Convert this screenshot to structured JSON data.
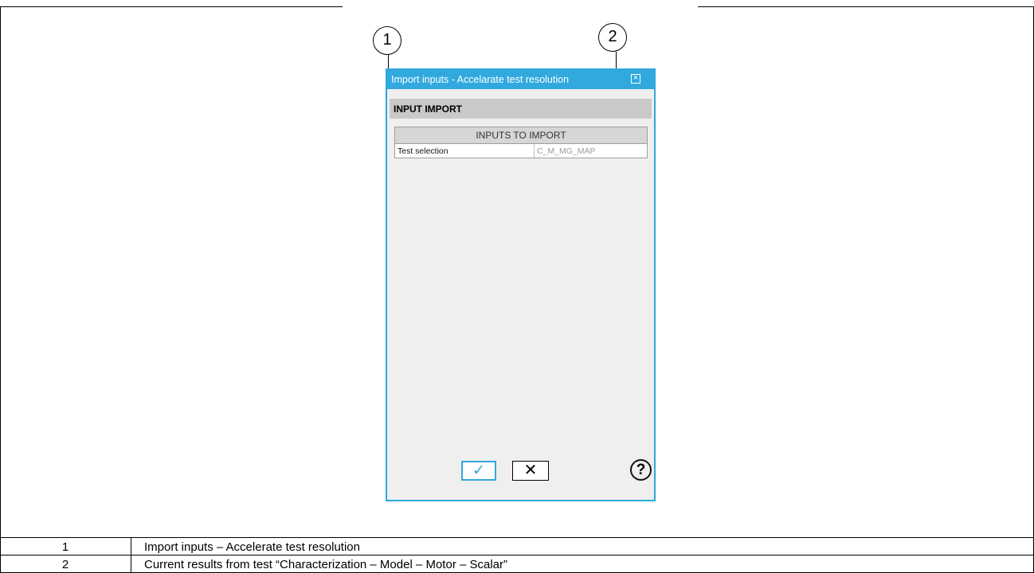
{
  "callouts": [
    "1",
    "2"
  ],
  "dialog": {
    "title": "Import inputs - Accelarate test resolution",
    "close_icon": "close-box-icon",
    "section_title": "INPUT IMPORT",
    "table": {
      "header": "INPUTS TO IMPORT",
      "rows": [
        {
          "name": "Test selection",
          "value": "C_M_MG_MAP"
        }
      ]
    },
    "buttons": {
      "ok_symbol": "✓",
      "cancel_symbol": "✕",
      "help_symbol": "?"
    },
    "colors": {
      "accent": "#31a9de",
      "panel_bg": "#efefef",
      "section_bg": "#c9c9c9"
    }
  },
  "legend": [
    {
      "num": "1",
      "text": "Import inputs – Accelerate test resolution"
    },
    {
      "num": "2",
      "text": "Current results from test “Characterization – Model – Motor – Scalar”"
    }
  ]
}
